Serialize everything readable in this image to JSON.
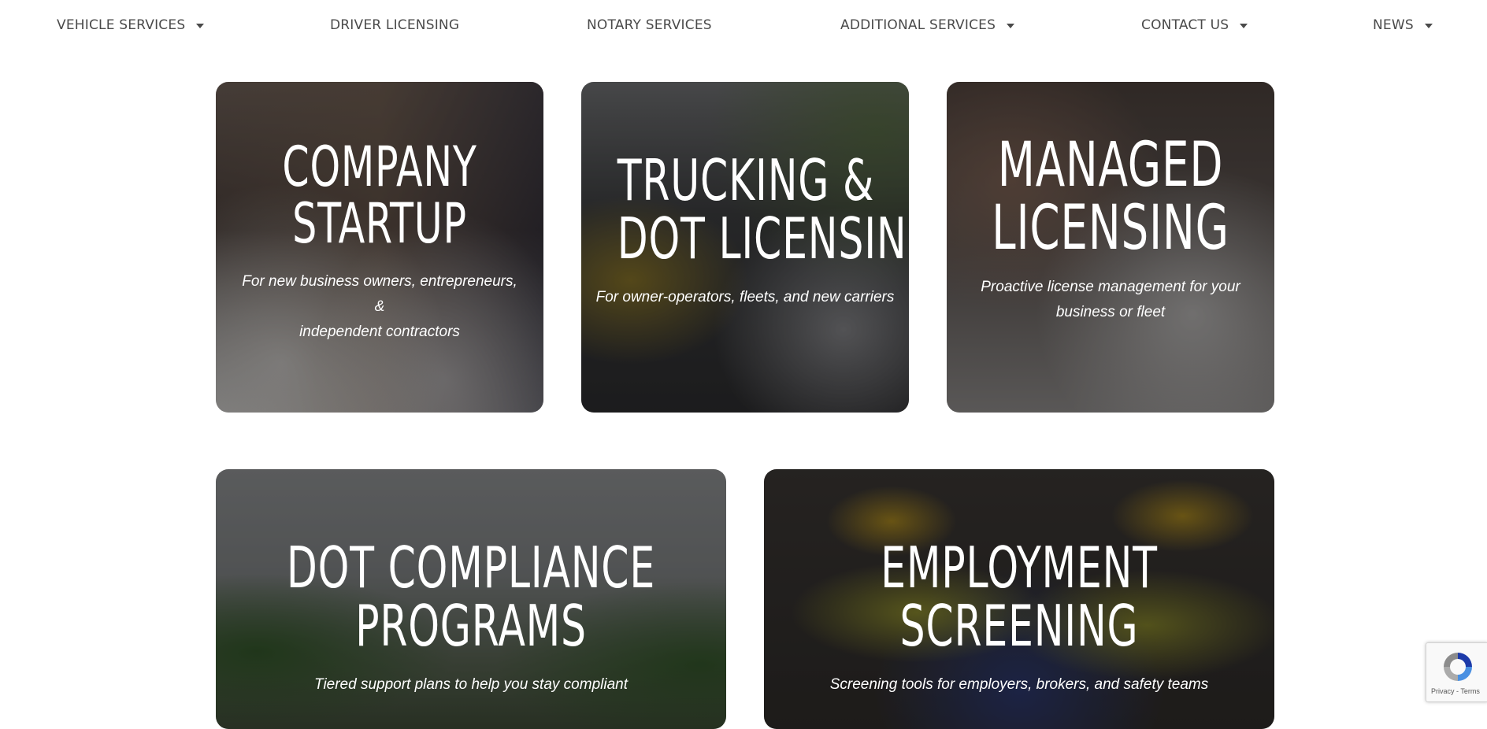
{
  "nav": {
    "items": [
      {
        "label": "VEHICLE SERVICES",
        "has_dropdown": true
      },
      {
        "label": "DRIVER LICENSING",
        "has_dropdown": false
      },
      {
        "label": "NOTARY SERVICES",
        "has_dropdown": false
      },
      {
        "label": "ADDITIONAL SERVICES",
        "has_dropdown": true
      },
      {
        "label": "CONTACT US",
        "has_dropdown": true
      },
      {
        "label": "NEWS",
        "has_dropdown": true
      }
    ]
  },
  "cards": [
    {
      "title_line1": "COMPANY",
      "title_line2": "STARTUP",
      "subtitle_line1": "For new business owners, entrepreneurs, &",
      "subtitle_line2": "independent contractors"
    },
    {
      "title_line1": "TRUCKING &",
      "title_line2": "DOT LICENSING",
      "subtitle_line1": "For owner-operators, fleets, and new carriers",
      "subtitle_line2": ""
    },
    {
      "title_line1": "MANAGED",
      "title_line2": "LICENSING",
      "subtitle_line1": "Proactive license management for your",
      "subtitle_line2": "business or fleet"
    },
    {
      "title_line1": "DOT COMPLIANCE",
      "title_line2": "PROGRAMS",
      "subtitle_line1": "Tiered support plans to help you stay compliant",
      "subtitle_line2": ""
    },
    {
      "title_line1": "EMPLOYMENT",
      "title_line2": "SCREENING",
      "subtitle_line1": "Screening tools for employers, brokers, and safety teams",
      "subtitle_line2": ""
    }
  ],
  "recaptcha": {
    "links": "Privacy - Terms"
  },
  "colors": {
    "nav_text": "#4a4a4a",
    "card_text": "#ffffff",
    "background": "#ffffff"
  },
  "icons": {
    "dropdown": "caret-down-icon",
    "recaptcha": "recaptcha-logo-icon"
  }
}
